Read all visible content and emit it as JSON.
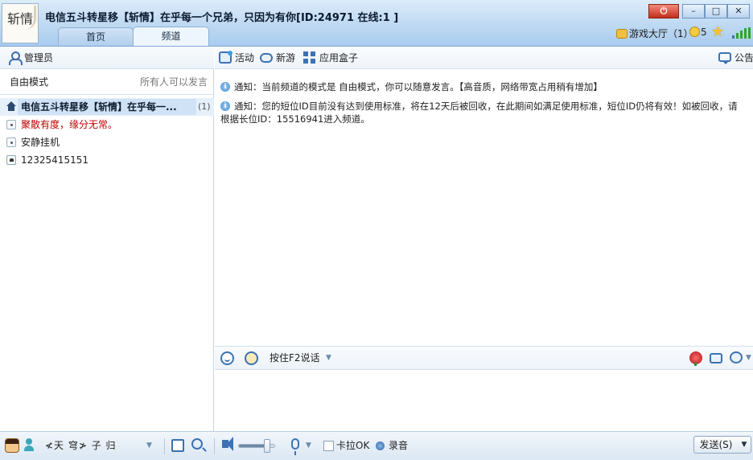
{
  "header": {
    "logo_text": "斩情",
    "title": "电信五斗转星移【斩情】在乎每一个兄弟，只因为有你[ID:24971 在线:1 ]",
    "tabs": [
      {
        "label": "首页"
      },
      {
        "label": "频道"
      }
    ],
    "window_buttons": {
      "power": "⏻",
      "minimize": "–",
      "maximize": "□",
      "close": "✕"
    },
    "game_hall": "游戏大厅（1）",
    "coin_count": "5"
  },
  "left": {
    "admin_label": "管理员",
    "mode_label": "自由模式",
    "mode_hint": "所有人可以发言",
    "channel": {
      "name": "电信五斗转星移【斩情】在乎每一...",
      "count": "(1)"
    },
    "rooms": [
      {
        "name": "聚散有度，缘分无常。",
        "color": "red"
      },
      {
        "name": "安静挂机"
      },
      {
        "name": "12325415151",
        "locked": true
      }
    ]
  },
  "right": {
    "toolbar": {
      "activity": "活动",
      "new_game": "新游",
      "app_box": "应用盒子",
      "notice": "公告"
    },
    "messages": [
      {
        "line1": "通知：当前频道的模式是 自由模式，你可以随意发言。【高音质，网络带宽占用稍有增加】"
      },
      {
        "line1": "通知：您的短位ID目前没有达到使用标准，将在12天后被回收，在此期间如满足使用标准，短位ID仍将有效！如被回收，请",
        "line2": "根据长位ID：15516941进入频道。"
      }
    ],
    "ptt_label": "按住F2说话"
  },
  "bottom": {
    "nickname": "≮天 穹≯ 子  归",
    "karaoke": "卡拉OK",
    "record": "录音",
    "send": "发送(S)",
    "volume": 0.8
  },
  "colors": {
    "header_top": "#dcecfa",
    "header_bottom": "#a9cbee",
    "accent": "#3b72b4",
    "red_text": "#c00000",
    "selection": "#cfe2f6"
  }
}
